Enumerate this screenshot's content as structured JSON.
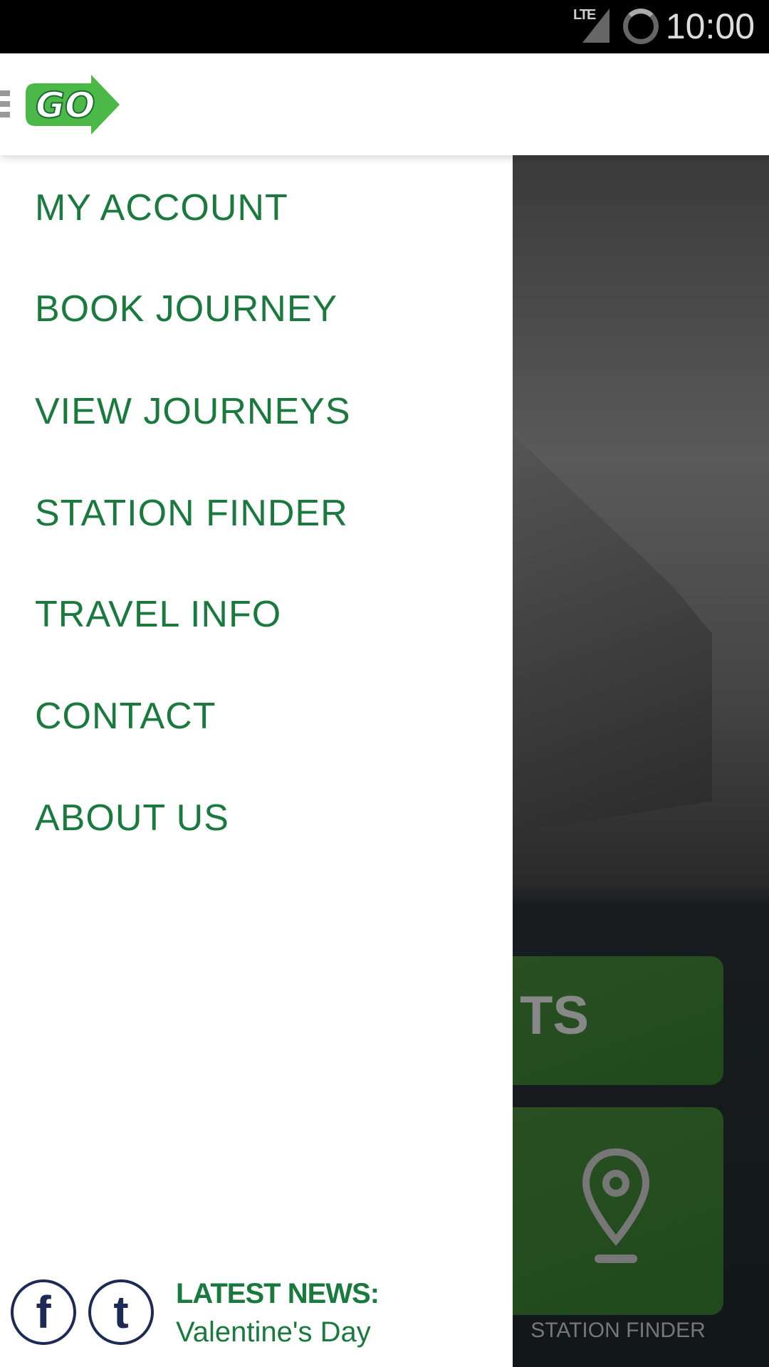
{
  "status_bar": {
    "network": "LTE",
    "time": "10:00"
  },
  "header": {
    "logo_text": "GO",
    "menu_icon": "hamburger-icon"
  },
  "drawer": {
    "items": [
      {
        "label": "MY ACCOUNT"
      },
      {
        "label": "BOOK JOURNEY"
      },
      {
        "label": "VIEW JOURNEYS"
      },
      {
        "label": "STATION FINDER"
      },
      {
        "label": "TRAVEL INFO"
      },
      {
        "label": "CONTACT"
      },
      {
        "label": "ABOUT US"
      }
    ],
    "social": {
      "facebook": "f",
      "twitter": "t"
    },
    "news": {
      "title": "LATEST NEWS:",
      "text": "Valentine's Day"
    }
  },
  "background": {
    "tile1_partial_text": "TS",
    "tile2_label": "STATION FINDER"
  },
  "colors": {
    "brand_green": "#1a7a3e",
    "logo_green": "#4cb848",
    "social_navy": "#1c2a55"
  }
}
